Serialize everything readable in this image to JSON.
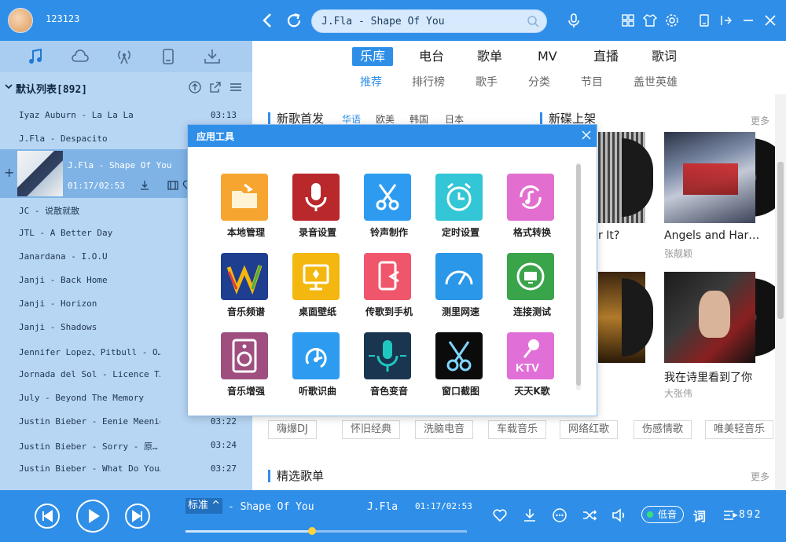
{
  "user": {
    "name": "123123"
  },
  "search": {
    "value": "J.Fla - Shape Of You"
  },
  "sidebar": {
    "playlist_title": "默认列表[892]",
    "now_playing": {
      "title": "J.Fla - Shape Of You",
      "time": "01:17/02:53"
    },
    "songs": [
      {
        "title": "Iyaz Auburn - La La La",
        "duration": "03:13"
      },
      {
        "title": "J.Fla - Despacito",
        "duration": ""
      },
      {
        "title": "JC - 说散就散",
        "duration": ""
      },
      {
        "title": "JTL - A Better Day",
        "duration": ""
      },
      {
        "title": "Janardana - I.O.U",
        "duration": ""
      },
      {
        "title": "Janji - Back Home",
        "duration": ""
      },
      {
        "title": "Janji - Horizon",
        "duration": ""
      },
      {
        "title": "Janji - Shadows",
        "duration": ""
      },
      {
        "title": "Jennifer Lopez、Pitbull - O…",
        "duration": ""
      },
      {
        "title": "Jornada del Sol - Licence T…",
        "duration": ""
      },
      {
        "title": "July - Beyond The Memory",
        "duration": ""
      },
      {
        "title": "Justin Bieber - Eenie Meenie",
        "duration": "03:22"
      },
      {
        "title": "Justin Bieber - Sorry - 原…",
        "duration": "03:24"
      },
      {
        "title": "Justin Bieber - What Do You…",
        "duration": "03:27"
      }
    ]
  },
  "main": {
    "tabs": [
      "乐库",
      "电台",
      "歌单",
      "MV",
      "直播",
      "歌词"
    ],
    "subtabs": [
      "推荐",
      "排行榜",
      "歌手",
      "分类",
      "节目",
      "盖世英雄"
    ],
    "new_songs": {
      "title": "新歌首发",
      "regions": [
        "华语",
        "欧美",
        "韩国",
        "日本"
      ]
    },
    "new_albums": {
      "title": "新碟上架",
      "more": "更多",
      "items": [
        {
          "title": "Angels and Har…",
          "artist": "张靓颖"
        },
        {
          "title": "我在诗里看到了你",
          "artist": "大张伟"
        }
      ],
      "partial_title": "r It?"
    },
    "tags": [
      "嗨爆DJ",
      "怀旧经典",
      "洗脑电音",
      "车载音乐",
      "网络红歌",
      "伤感情歌",
      "唯美轻音乐"
    ],
    "playlists": {
      "title": "精选歌单",
      "more": "更多"
    }
  },
  "dialog": {
    "title": "应用工具",
    "tools": [
      {
        "label": "本地管理",
        "icon": "folder-icon",
        "color": "#f7a531"
      },
      {
        "label": "录音设置",
        "icon": "microphone-icon",
        "color": "#b9282b"
      },
      {
        "label": "铃声制作",
        "icon": "scissors-icon",
        "color": "#2d9cf0"
      },
      {
        "label": "定时设置",
        "icon": "alarm-clock-icon",
        "color": "#32c6d6"
      },
      {
        "label": "格式转换",
        "icon": "music-convert-icon",
        "color": "#e26fd0"
      },
      {
        "label": "音乐频谱",
        "icon": "spectrum-icon",
        "color": "#1e3f8f"
      },
      {
        "label": "桌面壁纸",
        "icon": "wallpaper-icon",
        "color": "#f3b70f"
      },
      {
        "label": "传歌到手机",
        "icon": "phone-transfer-icon",
        "color": "#f0566b"
      },
      {
        "label": "测里网速",
        "icon": "speed-gauge-icon",
        "color": "#2a97e8"
      },
      {
        "label": "连接测试",
        "icon": "globe-network-icon",
        "color": "#3aa44a"
      },
      {
        "label": "音乐增强",
        "icon": "speaker-icon",
        "color": "#9e4f7f"
      },
      {
        "label": "听歌识曲",
        "icon": "song-recognition-icon",
        "color": "#2d9cf0"
      },
      {
        "label": "音色变音",
        "icon": "voice-mic-icon",
        "color": "#1a3550"
      },
      {
        "label": "窗口截图",
        "icon": "screenshot-scissors-icon",
        "color": "#0b0b0b"
      },
      {
        "label": "天天K歌",
        "icon": "ktv-icon",
        "color": "#e06fd8"
      }
    ]
  },
  "player": {
    "quality": "标准",
    "song": "- Shape Of You",
    "artist": "J.Fla",
    "time": "01:17/02:53",
    "progress": 0.45,
    "low_quality": "低音",
    "lyrics": "词",
    "queue_count": "892"
  },
  "colors": {
    "accent": "#2f8fe8"
  }
}
